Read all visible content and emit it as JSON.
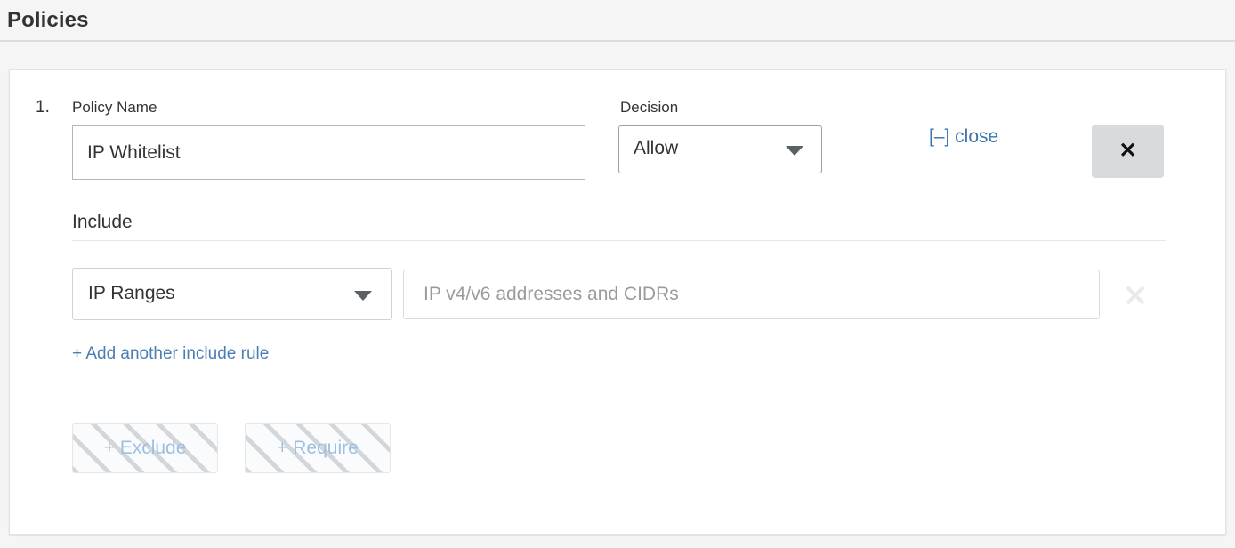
{
  "page": {
    "title": "Policies"
  },
  "policy": {
    "index": "1.",
    "name_label": "Policy Name",
    "name_value": "IP Whitelist",
    "name_placeholder": "",
    "decision_label": "Decision",
    "decision_value": "Allow",
    "close_link": "[–] close",
    "delete_icon": "✕",
    "include": {
      "heading": "Include",
      "rule_type_value": "IP Ranges",
      "rule_value": "",
      "rule_placeholder": "IP v4/v6 addresses and CIDRs",
      "add_rule_label": "+ Add another include rule"
    },
    "exclude_button_label": "+ Exclude",
    "require_button_label": "+ Require"
  },
  "colors": {
    "page_background": "#f5f5f5",
    "card_background": "#ffffff",
    "link_blue": "#3a74ab",
    "add_link_blue": "#4a7fb5",
    "hatched_text_blue": "#9dbfe0",
    "delete_button_grey": "#d8dadc",
    "text_primary": "#333333",
    "placeholder_grey": "#9b9b9b"
  }
}
